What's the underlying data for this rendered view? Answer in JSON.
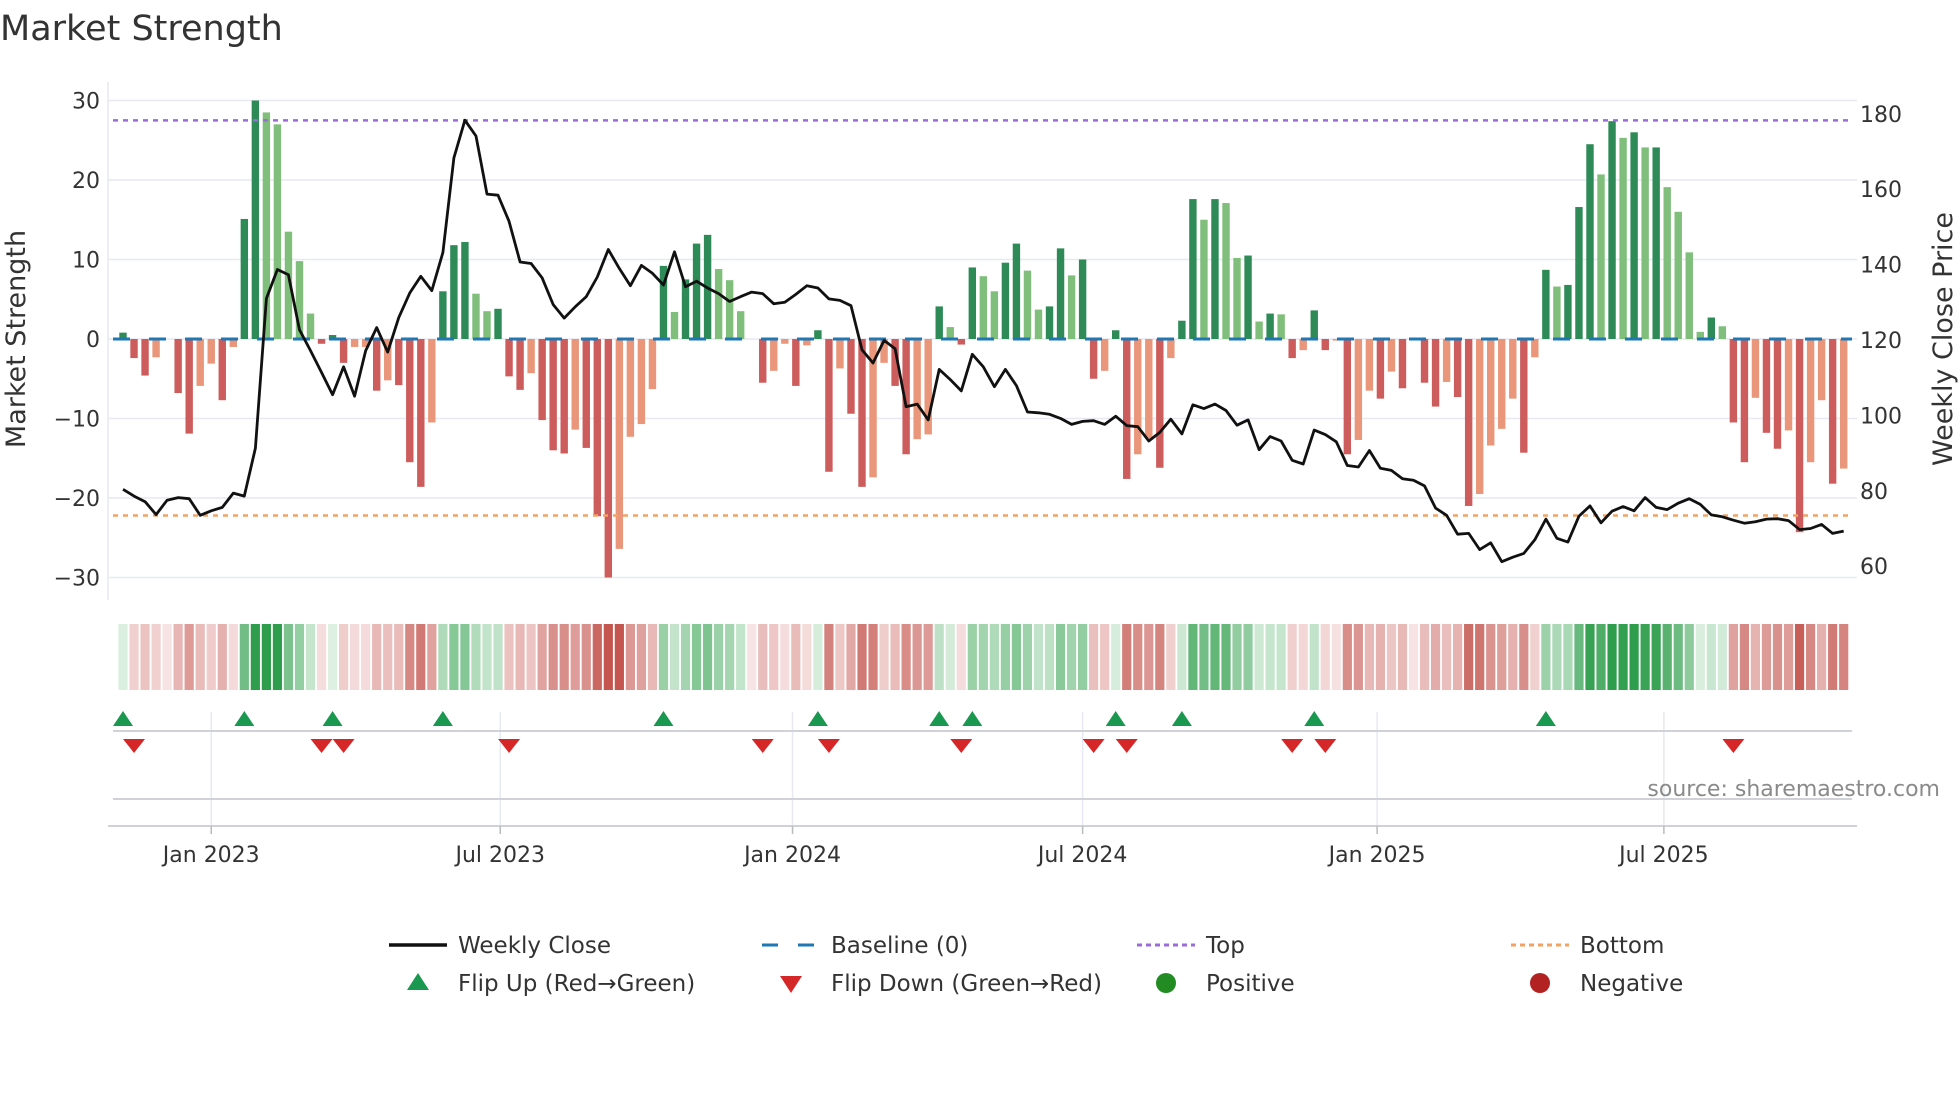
{
  "chart_data": {
    "type": "bar",
    "title": "Market Strength",
    "ylabel": "Market Strength",
    "y2label": "Weekly Close Price",
    "ylim": [
      -30,
      30
    ],
    "y2lim": [
      60,
      180
    ],
    "yticks": [
      "30",
      "20",
      "10",
      "0",
      "−10",
      "−20",
      "−30"
    ],
    "ytick_values": [
      30,
      20,
      10,
      0,
      -10,
      -20,
      -30
    ],
    "y2ticks": [
      "180",
      "160",
      "140",
      "120",
      "100",
      "80",
      "60"
    ],
    "y2tick_values": [
      180,
      160,
      140,
      120,
      100,
      80,
      60
    ],
    "grid": true,
    "x_ticks": [
      {
        "label": "Jan 2023",
        "week_index": 8
      },
      {
        "label": "Jul 2023",
        "week_index": 34.2
      },
      {
        "label": "Jan 2024",
        "week_index": 60.7
      },
      {
        "label": "Jul 2024",
        "week_index": 87
      },
      {
        "label": "Jan 2025",
        "week_index": 113.7
      },
      {
        "label": "Jul 2025",
        "week_index": 139.7
      }
    ],
    "top_level": 27.5,
    "bottom_level": -22.2,
    "baseline": 0,
    "strength": [
      0.8,
      -2.4,
      -4.6,
      -2.3,
      0,
      -6.8,
      -11.9,
      -5.9,
      -3.1,
      -7.7,
      -1.0,
      15.1,
      30,
      28.5,
      27.0,
      13.5,
      9.8,
      3.2,
      -0.6,
      0.5,
      -3.0,
      -1.0,
      -1.0,
      -6.5,
      -5.2,
      -5.8,
      -15.5,
      -18.6,
      -10.5,
      6.0,
      11.8,
      12.2,
      5.7,
      3.5,
      3.8,
      -4.7,
      -6.4,
      -4.3,
      -10.2,
      -14.0,
      -14.4,
      -11.4,
      -13.7,
      -22.3,
      -30,
      -26.4,
      -12.3,
      -10.7,
      -6.3,
      9.2,
      3.4,
      7.5,
      12.0,
      13.1,
      8.8,
      7.4,
      3.5,
      0,
      -5.5,
      -4.0,
      -0.6,
      -5.9,
      -0.8,
      1.1,
      -16.7,
      -3.7,
      -9.4,
      -18.6,
      -17.4,
      -3.0,
      -5.9,
      -14.5,
      -12.6,
      -12.0,
      4.1,
      1.5,
      -0.7,
      9.0,
      7.9,
      6.0,
      9.6,
      12.0,
      8.6,
      3.7,
      4.1,
      11.4,
      8.0,
      10.0,
      -5.0,
      -4.0,
      1.1,
      -17.6,
      -14.5,
      -12.5,
      -16.2,
      -2.4,
      2.3,
      17.6,
      15.0,
      17.6,
      17.1,
      10.2,
      10.5,
      2.2,
      3.2,
      3.1,
      -2.4,
      -1.4,
      3.6,
      -1.4,
      -0.2,
      -14.5,
      -12.7,
      -6.5,
      -7.5,
      -4.1,
      -6.2,
      0,
      -5.5,
      -8.5,
      -5.4,
      -7.3,
      -21.0,
      -19.5,
      -13.4,
      -11.3,
      -7.5,
      -14.3,
      -2.3,
      8.7,
      6.6,
      6.8,
      16.6,
      24.5,
      20.7,
      27.4,
      25.3,
      26.0,
      24.1,
      24.1,
      19.1,
      16.0,
      10.9,
      0.9,
      2.7,
      1.6,
      -10.5,
      -15.5,
      -7.4,
      -11.8,
      -13.8,
      -11.5,
      -24.3,
      -15.5,
      -7.7,
      -18.2,
      -16.3
    ],
    "bar_shade": "DRRSNRRSSRSDDLLLLLRDRSSRSRRRSDDDLLDRRSRRRSRRRSSSSDLDDDLLLNRSSRSDRSRRSSRRSSDLRDLLDDLLDDLDRSDRSSRSDDLDLLDLDLRSDRSRSSRSRNRRSRRSSSSRSDLDDDLDLDLDLLLLDLRRSRRSRSSRS",
    "weekly_close": [
      80.4,
      78.6,
      77.1,
      73.7,
      77.5,
      78.2,
      77.9,
      73.5,
      74.7,
      75.6,
      79.4,
      78.6,
      91.3,
      131.0,
      138.7,
      137.3,
      122.7,
      117.2,
      111.4,
      105.5,
      112.9,
      105.1,
      117.2,
      123.3,
      116.8,
      126.0,
      132.5,
      136.9,
      133.1,
      143.2,
      168.3,
      178.3,
      174.1,
      158.7,
      158.4,
      151.5,
      140.7,
      140.3,
      136.5,
      129.4,
      125.8,
      128.8,
      131.5,
      136.7,
      144.0,
      139.0,
      134.4,
      139.8,
      137.7,
      134.6,
      143.4,
      134.1,
      135.6,
      133.8,
      132.3,
      130.2,
      131.5,
      132.7,
      132.3,
      129.6,
      130.0,
      132.1,
      134.4,
      133.8,
      130.9,
      130.5,
      129.1,
      117.4,
      113.9,
      119.9,
      117.7,
      102.3,
      103.0,
      98.8,
      112.2,
      109.5,
      106.5,
      116.2,
      112.9,
      107.6,
      112.2,
      107.9,
      100.9,
      100.7,
      100.3,
      99.2,
      97.6,
      98.4,
      98.6,
      97.6,
      99.8,
      97.3,
      97.0,
      93.2,
      95.5,
      99.0,
      95.1,
      102.8,
      101.8,
      103.0,
      101.3,
      97.4,
      98.8,
      90.9,
      94.4,
      93.2,
      88.1,
      87.1,
      96.1,
      94.9,
      93.0,
      86.7,
      86.3,
      90.7,
      86.0,
      85.4,
      83.2,
      82.8,
      81.3,
      75.4,
      73.5,
      68.5,
      68.7,
      64.4,
      66.2,
      61.2,
      62.4,
      63.4,
      67.0,
      72.5,
      67.4,
      66.4,
      73.3,
      76.0,
      71.5,
      74.6,
      75.8,
      74.7,
      78.2,
      75.6,
      75.0,
      76.7,
      77.9,
      76.4,
      73.6,
      73.1,
      72.2,
      71.4,
      71.8,
      72.5,
      72.6,
      72.1,
      69.7,
      70.0,
      71.1,
      68.7,
      69.3
    ],
    "flip_up_indices": [
      0,
      11,
      19,
      29,
      49,
      63,
      74,
      77,
      90,
      96,
      108,
      129
    ],
    "flip_down_indices": [
      1,
      18,
      20,
      35,
      58,
      64,
      76,
      88,
      91,
      106,
      109,
      146
    ],
    "colors": {
      "rising_positive": "#2e8b57",
      "falling_positive": "#7fbf7b",
      "falling_negative": "#cd5c5c",
      "rising_negative": "#e9967a",
      "line": "#111111",
      "baseline": "#1f77b4",
      "top": "#9b6bdc",
      "bottom": "#f4a261",
      "flip_up": "#1a9850",
      "flip_down": "#d62728",
      "positive": "#228b22",
      "negative": "#b22222"
    },
    "legend": {
      "placement": "bottom",
      "items": [
        {
          "label": "Weekly Close",
          "symbol": "line"
        },
        {
          "label": "Baseline (0)",
          "symbol": "dash"
        },
        {
          "label": "Top",
          "symbol": "dot-purple"
        },
        {
          "label": "Bottom",
          "symbol": "dot-orange"
        },
        {
          "label": "Flip Up (Red→Green)",
          "symbol": "triangle-up"
        },
        {
          "label": "Flip Down (Green→Red)",
          "symbol": "triangle-down"
        },
        {
          "label": "Positive",
          "symbol": "circle-green"
        },
        {
          "label": "Negative",
          "symbol": "circle-red"
        }
      ]
    },
    "source": "source: sharemaestro.com"
  }
}
